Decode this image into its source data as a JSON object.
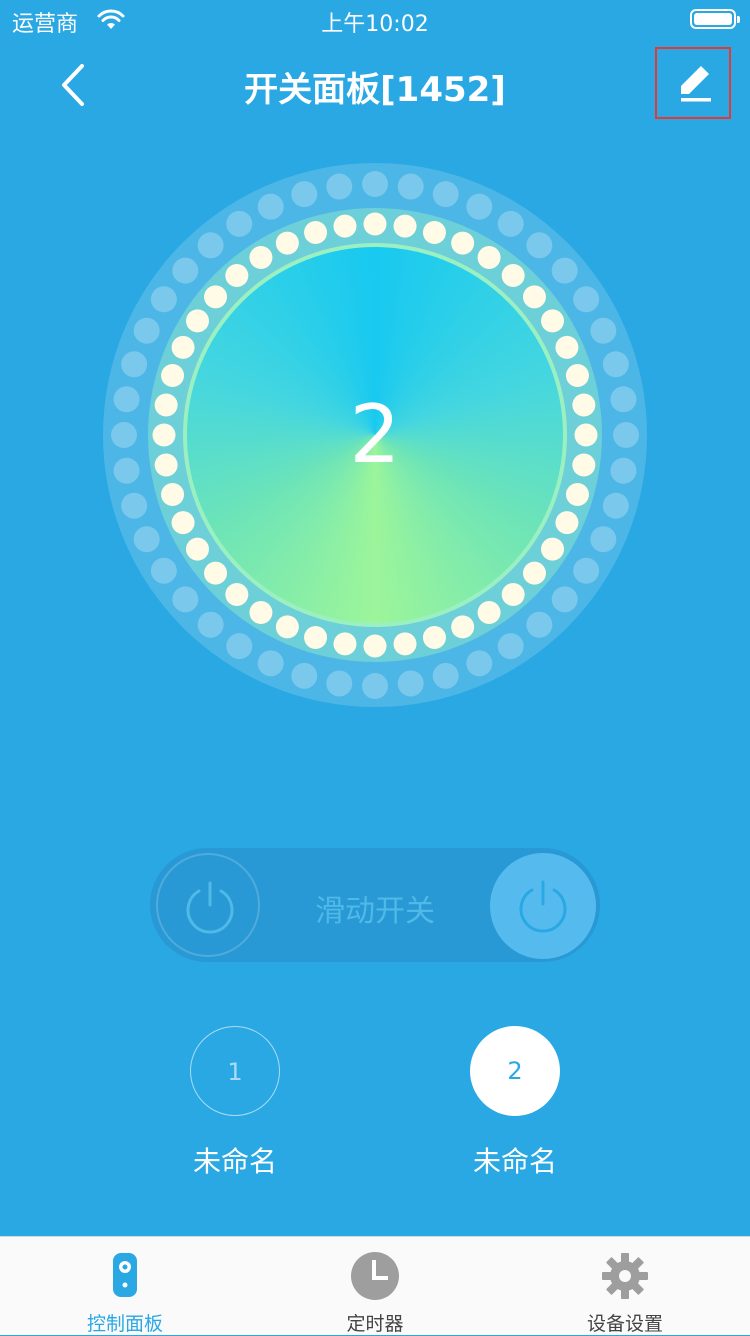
{
  "status_bar": {
    "carrier": "运营商",
    "time": "上午10:02"
  },
  "nav": {
    "title": "开关面板[1452]"
  },
  "dial": {
    "number": "2"
  },
  "slide_switch": {
    "label": "滑动开关"
  },
  "channels": [
    {
      "number": "1",
      "label": "未命名",
      "selected": false
    },
    {
      "number": "2",
      "label": "未命名",
      "selected": true
    }
  ],
  "tabs": [
    {
      "label": "控制面板",
      "icon": "remote-control-icon",
      "active": true
    },
    {
      "label": "定时器",
      "icon": "clock-icon",
      "active": false
    },
    {
      "label": "设备设置",
      "icon": "gear-icon",
      "active": false
    }
  ],
  "colors": {
    "background": "#29a8e4",
    "highlight": "#e53935",
    "tab_active": "#29a8e4",
    "tab_inactive": "#9e9e9e"
  }
}
